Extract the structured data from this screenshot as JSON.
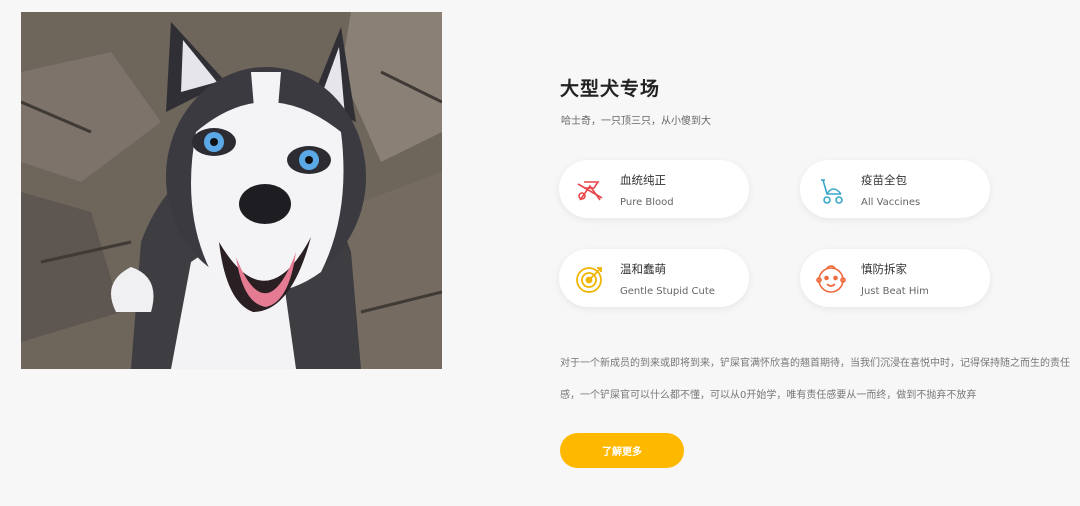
{
  "section": {
    "title": "大型犬专场",
    "subtitle": "哈士奇，一只顶三只，从小傻到大"
  },
  "features": [
    {
      "cn": "血统纯正",
      "en": "Pure Blood",
      "icon": "scissors-flag-icon",
      "color": "#e8454a"
    },
    {
      "cn": "疫苗全包",
      "en": "All Vaccines",
      "icon": "stroller-icon",
      "color": "#3aa7c9"
    },
    {
      "cn": "温和蠢萌",
      "en": "Gentle Stupid Cute",
      "icon": "target-icon",
      "color": "#f1b400"
    },
    {
      "cn": "慎防拆家",
      "en": "Just Beat Him",
      "icon": "baby-face-icon",
      "color": "#ef6a3c"
    }
  ],
  "description": "对于一个新成员的到来或即将到来，铲屎官满怀欣喜的翘首期待，当我们沉浸在喜悦中时，记得保持随之而生的责任感，一个铲屎官可以什么都不懂，可以从0开始学，唯有责任感要从一而终，做到不抛弃不放弃",
  "cta_label": "了解更多",
  "colors": {
    "accent": "#ffb800",
    "background": "#f7f7f7"
  }
}
